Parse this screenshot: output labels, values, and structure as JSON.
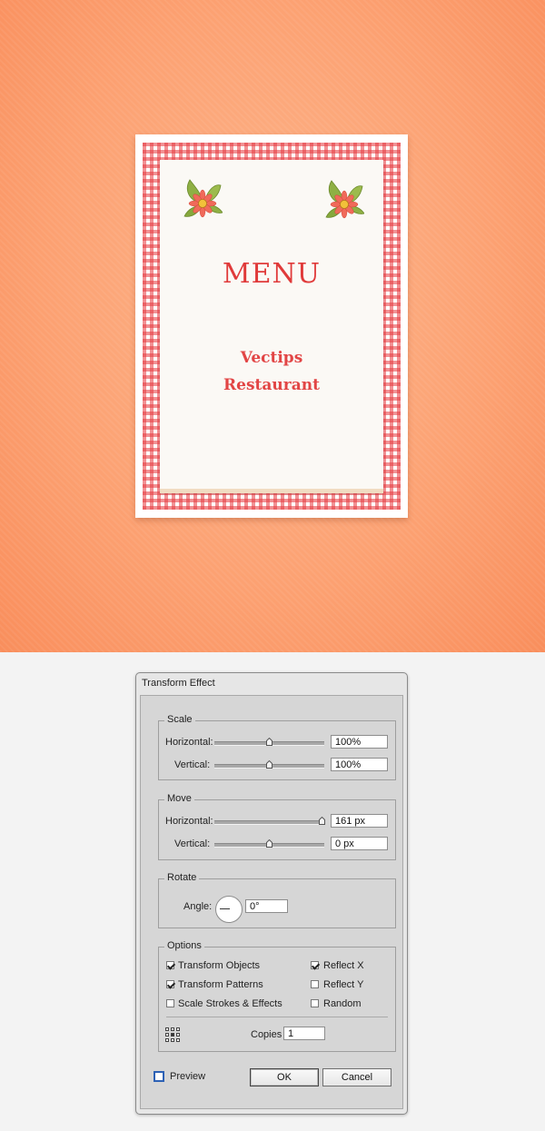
{
  "artwork": {
    "menu_title": "MENU",
    "restaurant_line1": "Vectips",
    "restaurant_line2": "Restaurant",
    "colors": {
      "background": "#fca273",
      "gingham": "#e6373c",
      "title": "#e03a3a"
    }
  },
  "dialog": {
    "title": "Transform Effect",
    "scale": {
      "label": "Scale",
      "horizontal_label": "Horizontal:",
      "horizontal_value": "100%",
      "vertical_label": "Vertical:",
      "vertical_value": "100%"
    },
    "move": {
      "label": "Move",
      "horizontal_label": "Horizontal:",
      "horizontal_value": "161 px",
      "vertical_label": "Vertical:",
      "vertical_value": "0 px"
    },
    "rotate": {
      "label": "Rotate",
      "angle_label": "Angle:",
      "angle_value": "0°"
    },
    "options": {
      "label": "Options",
      "transform_objects": {
        "label": "Transform Objects",
        "checked": true
      },
      "transform_patterns": {
        "label": "Transform Patterns",
        "checked": true
      },
      "scale_strokes": {
        "label": "Scale Strokes & Effects",
        "checked": false
      },
      "reflect_x": {
        "label": "Reflect X",
        "checked": true
      },
      "reflect_y": {
        "label": "Reflect Y",
        "checked": false
      },
      "random": {
        "label": "Random",
        "checked": false
      },
      "copies_label": "Copies",
      "copies_value": "1"
    },
    "preview": {
      "label": "Preview",
      "checked": false
    },
    "buttons": {
      "ok": "OK",
      "cancel": "Cancel"
    }
  }
}
